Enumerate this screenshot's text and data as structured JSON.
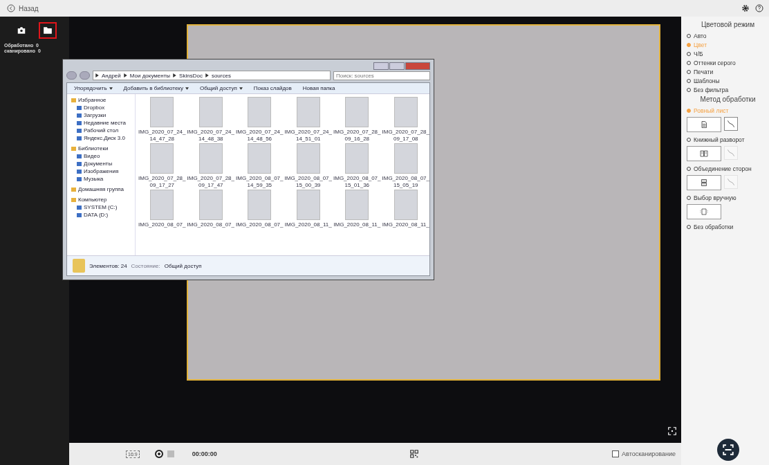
{
  "top_bar": {
    "back_label": "Назад"
  },
  "left_sidebar": {
    "tools": [
      {
        "selected": false
      },
      {
        "selected": true
      }
    ],
    "counters": [
      {
        "label": "Обработано",
        "value": "0"
      },
      {
        "label": "сканировано",
        "value": "0"
      }
    ]
  },
  "explorer": {
    "path": [
      "Андрей",
      "Мои документы",
      "SkinsDoc",
      "sources"
    ],
    "search": {
      "placeholder": "Поиск: sources"
    },
    "toolbar": [
      {
        "label": "Упорядочить",
        "dropdown": true
      },
      {
        "label": "Добавить в библиотеку",
        "dropdown": true
      },
      {
        "label": "Общий доступ",
        "dropdown": true
      },
      {
        "label": "Показ слайдов",
        "dropdown": false
      },
      {
        "label": "Новая папка",
        "dropdown": false
      }
    ],
    "nav": [
      {
        "label": "Избранное",
        "children": [
          {
            "label": "Dropbox"
          },
          {
            "label": "Загрузки"
          },
          {
            "label": "Недавние места"
          },
          {
            "label": "Рабочий стол"
          },
          {
            "label": "Яндекс.Диск 3.0"
          }
        ]
      },
      {
        "label": "Библиотеки",
        "children": [
          {
            "label": "Видео"
          },
          {
            "label": "Документы"
          },
          {
            "label": "Изображения"
          },
          {
            "label": "Музыка"
          }
        ]
      },
      {
        "label": "Домашняя группа"
      },
      {
        "label": "Компьютер",
        "children": [
          {
            "label": "SYSTEM (C:)"
          },
          {
            "label": "DATA (D:)"
          }
        ]
      }
    ],
    "files": [
      {
        "name": [
          "IMG_2020_07_24_",
          "14_47_28"
        ]
      },
      {
        "name": [
          "IMG_2020_07_24_",
          "14_48_38"
        ]
      },
      {
        "name": [
          "IMG_2020_07_24_",
          "14_48_56"
        ]
      },
      {
        "name": [
          "IMG_2020_07_24_",
          "14_51_01"
        ]
      },
      {
        "name": [
          "IMG_2020_07_28_",
          "09_16_28"
        ]
      },
      {
        "name": [
          "IMG_2020_07_28_",
          "09_17_08"
        ]
      },
      {
        "name": [
          "IMG_2020_07_28_",
          "09_17_27"
        ]
      },
      {
        "name": [
          "IMG_2020_07_28_",
          "09_17_47"
        ]
      },
      {
        "name": [
          "IMG_2020_08_07_",
          "14_59_35"
        ]
      },
      {
        "name": [
          "IMG_2020_08_07_",
          "15_00_39"
        ]
      },
      {
        "name": [
          "IMG_2020_08_07_",
          "15_01_36"
        ]
      },
      {
        "name": [
          "IMG_2020_08_07_",
          "15_05_19"
        ]
      },
      {
        "name": [
          "IMG_2020_08_07_"
        ]
      },
      {
        "name": [
          "IMG_2020_08_07_"
        ]
      },
      {
        "name": [
          "IMG_2020_08_07_"
        ]
      },
      {
        "name": [
          "IMG_2020_08_11_"
        ]
      },
      {
        "name": [
          "IMG_2020_08_11_"
        ]
      },
      {
        "name": [
          "IMG_2020_08_11_"
        ]
      }
    ],
    "status": {
      "count": "Элементов: 24",
      "state_label": "Состояние:",
      "state_value": "Общий доступ"
    }
  },
  "bottom_bar": {
    "aspect": "16:9",
    "time": "00:00:00",
    "autoscan": {
      "label": "Автосканирование",
      "checked": false
    }
  },
  "right_panel": {
    "color_mode": {
      "title": "Цветовой режим",
      "options": [
        {
          "label": "Авто",
          "selected": false
        },
        {
          "label": "Цвет",
          "selected": true
        },
        {
          "label": "Ч/Б",
          "selected": false
        },
        {
          "label": "Оттенки серого",
          "selected": false
        },
        {
          "label": "Печати",
          "selected": false
        },
        {
          "label": "Шаблоны",
          "selected": false
        },
        {
          "label": "Без фильтра",
          "selected": false
        }
      ]
    },
    "processing": {
      "title": "Метод обработки",
      "options": [
        {
          "label": "Ровный лист",
          "selected": true,
          "kind": "pair",
          "secondary_disabled": false
        },
        {
          "label": "Книжный разворот",
          "selected": false,
          "kind": "pair",
          "secondary_disabled": true
        },
        {
          "label": "Объединение сторон",
          "selected": false,
          "kind": "pair",
          "secondary_disabled": true
        },
        {
          "label": "Выбор вручную",
          "selected": false,
          "kind": "single"
        },
        {
          "label": "Без обработки",
          "selected": false,
          "kind": "plain"
        }
      ]
    }
  }
}
